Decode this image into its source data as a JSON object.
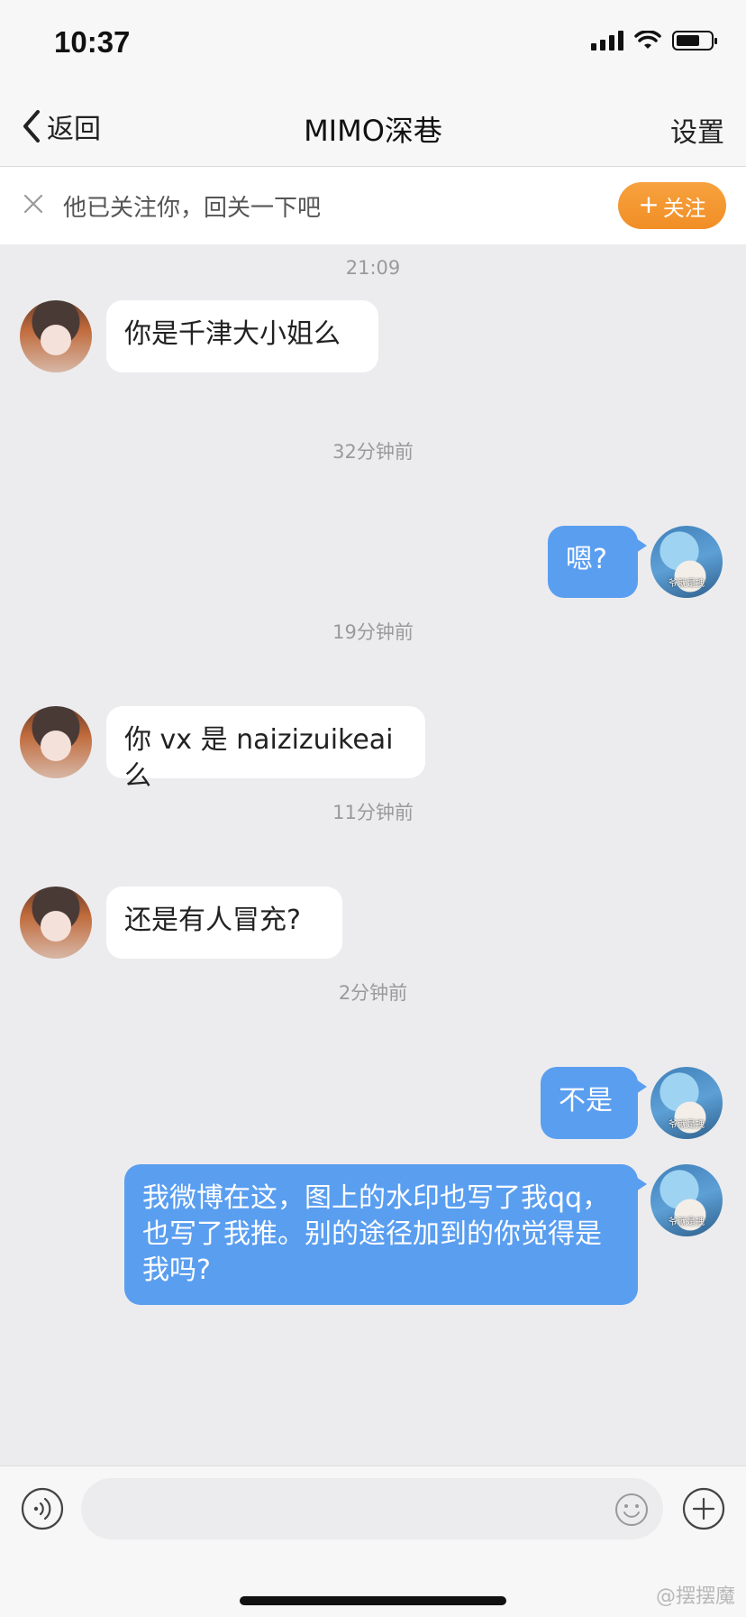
{
  "status_bar": {
    "time": "10:37",
    "battery_level": 0.7
  },
  "nav": {
    "back_label": "返回",
    "title": "MIMO深巷",
    "settings_label": "设置"
  },
  "follow_banner": {
    "text": "他已关注你，回关一下吧",
    "button_label": "关注"
  },
  "messages": [
    {
      "timestamp": "21:09",
      "side": "incoming",
      "text": "你是千津大小姐么"
    },
    {
      "timestamp": "32分钟前",
      "side": "outgoing",
      "text": "嗯?"
    },
    {
      "timestamp": "19分钟前",
      "side": "incoming",
      "text": "你 vx 是 naizizuikeai 么"
    },
    {
      "timestamp": "11分钟前",
      "side": "incoming",
      "text": "还是有人冒充?"
    },
    {
      "timestamp": "2分钟前",
      "side": "outgoing",
      "text": "不是"
    },
    {
      "timestamp": "",
      "side": "outgoing",
      "text": "我微博在这，图上的水印也写了我qq，也写了我推。别的途径加到的你觉得是我吗?"
    }
  ],
  "avatar_caption": "爷就是拽",
  "input": {
    "value": "",
    "placeholder": ""
  },
  "watermark": "@摆摆魔",
  "colors": {
    "accent_orange": "#f18e25",
    "bubble_blue": "#5a9ef0",
    "background": "#ececee"
  },
  "icons": [
    "back-chevron-icon",
    "close-icon",
    "plus-icon",
    "voice-icon",
    "emoji-icon",
    "add-icon"
  ]
}
